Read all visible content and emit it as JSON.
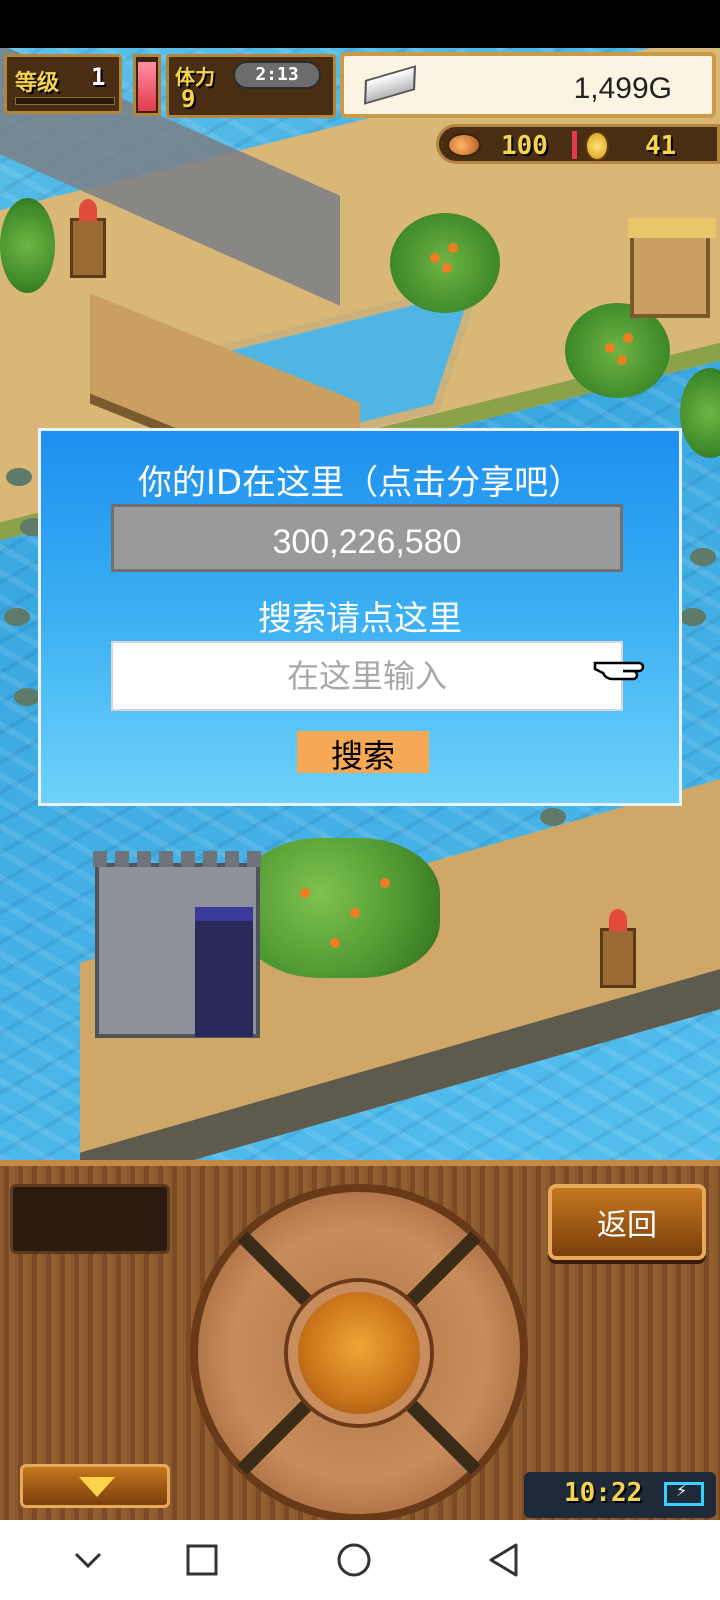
{
  "hud": {
    "level_label": "等级",
    "level_value": "1",
    "stamina_label": "体力",
    "stamina_value": "9",
    "stamina_fill_fraction": 0.95,
    "timer": "2:13",
    "money": "1,499G",
    "food": "100",
    "coins": "41"
  },
  "dialog": {
    "title": "你的ID在这里（点击分享吧）",
    "id_value": "300,226,580",
    "search_label": "搜索请点这里",
    "search_placeholder": "在这里输入",
    "search_button": "搜索"
  },
  "panel": {
    "back_button": "返回",
    "clock": "10:22"
  },
  "icons": {
    "silver": "silver-ingot-icon",
    "food": "food-icon",
    "coin": "coin-icon",
    "pointer": "pointing-hand-icon",
    "battery": "battery-charging-icon",
    "dropdown": "triangle-down-icon"
  },
  "colors": {
    "dialog_top": "#1d8ff0",
    "dialog_bottom": "#6ed2fb",
    "search_button": "#f5a955",
    "id_box": "#9a9a9a"
  }
}
